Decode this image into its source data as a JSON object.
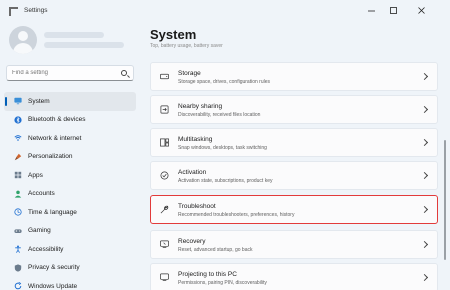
{
  "window": {
    "title": "Settings"
  },
  "sidebar": {
    "search_placeholder": "Find a setting",
    "items": [
      {
        "label": "System",
        "icon": "monitor-icon",
        "active": true
      },
      {
        "label": "Bluetooth & devices",
        "icon": "bluetooth-icon"
      },
      {
        "label": "Network & internet",
        "icon": "wifi-icon"
      },
      {
        "label": "Personalization",
        "icon": "brush-icon"
      },
      {
        "label": "Apps",
        "icon": "apps-icon"
      },
      {
        "label": "Accounts",
        "icon": "person-icon"
      },
      {
        "label": "Time & language",
        "icon": "globe-clock-icon"
      },
      {
        "label": "Gaming",
        "icon": "gamepad-icon"
      },
      {
        "label": "Accessibility",
        "icon": "accessibility-icon"
      },
      {
        "label": "Privacy & security",
        "icon": "shield-icon"
      },
      {
        "label": "Windows Update",
        "icon": "update-icon"
      }
    ]
  },
  "main": {
    "title": "System",
    "header_strip": "Top, battery usage, battery saver",
    "cards": [
      {
        "title": "Storage",
        "subtitle": "Storage space, drives, configuration rules",
        "icon": "storage-icon"
      },
      {
        "title": "Nearby sharing",
        "subtitle": "Discoverability, received files location",
        "icon": "nearby-sharing-icon"
      },
      {
        "title": "Multitasking",
        "subtitle": "Snap windows, desktops, task switching",
        "icon": "multitasking-icon"
      },
      {
        "title": "Activation",
        "subtitle": "Activation state, subscriptions, product key",
        "icon": "activation-icon"
      },
      {
        "title": "Troubleshoot",
        "subtitle": "Recommended troubleshooters, preferences, history",
        "icon": "wrench-icon",
        "highlighted": true
      },
      {
        "title": "Recovery",
        "subtitle": "Reset, advanced startup, go back",
        "icon": "recovery-icon"
      },
      {
        "title": "Projecting to this PC",
        "subtitle": "Permissions, pairing PIN, discoverability",
        "icon": "projecting-icon"
      }
    ]
  },
  "colors": {
    "accent": "#005fb8",
    "highlight_border": "#e23b3b",
    "background": "#eff4f9",
    "card": "#fbfbfc"
  }
}
